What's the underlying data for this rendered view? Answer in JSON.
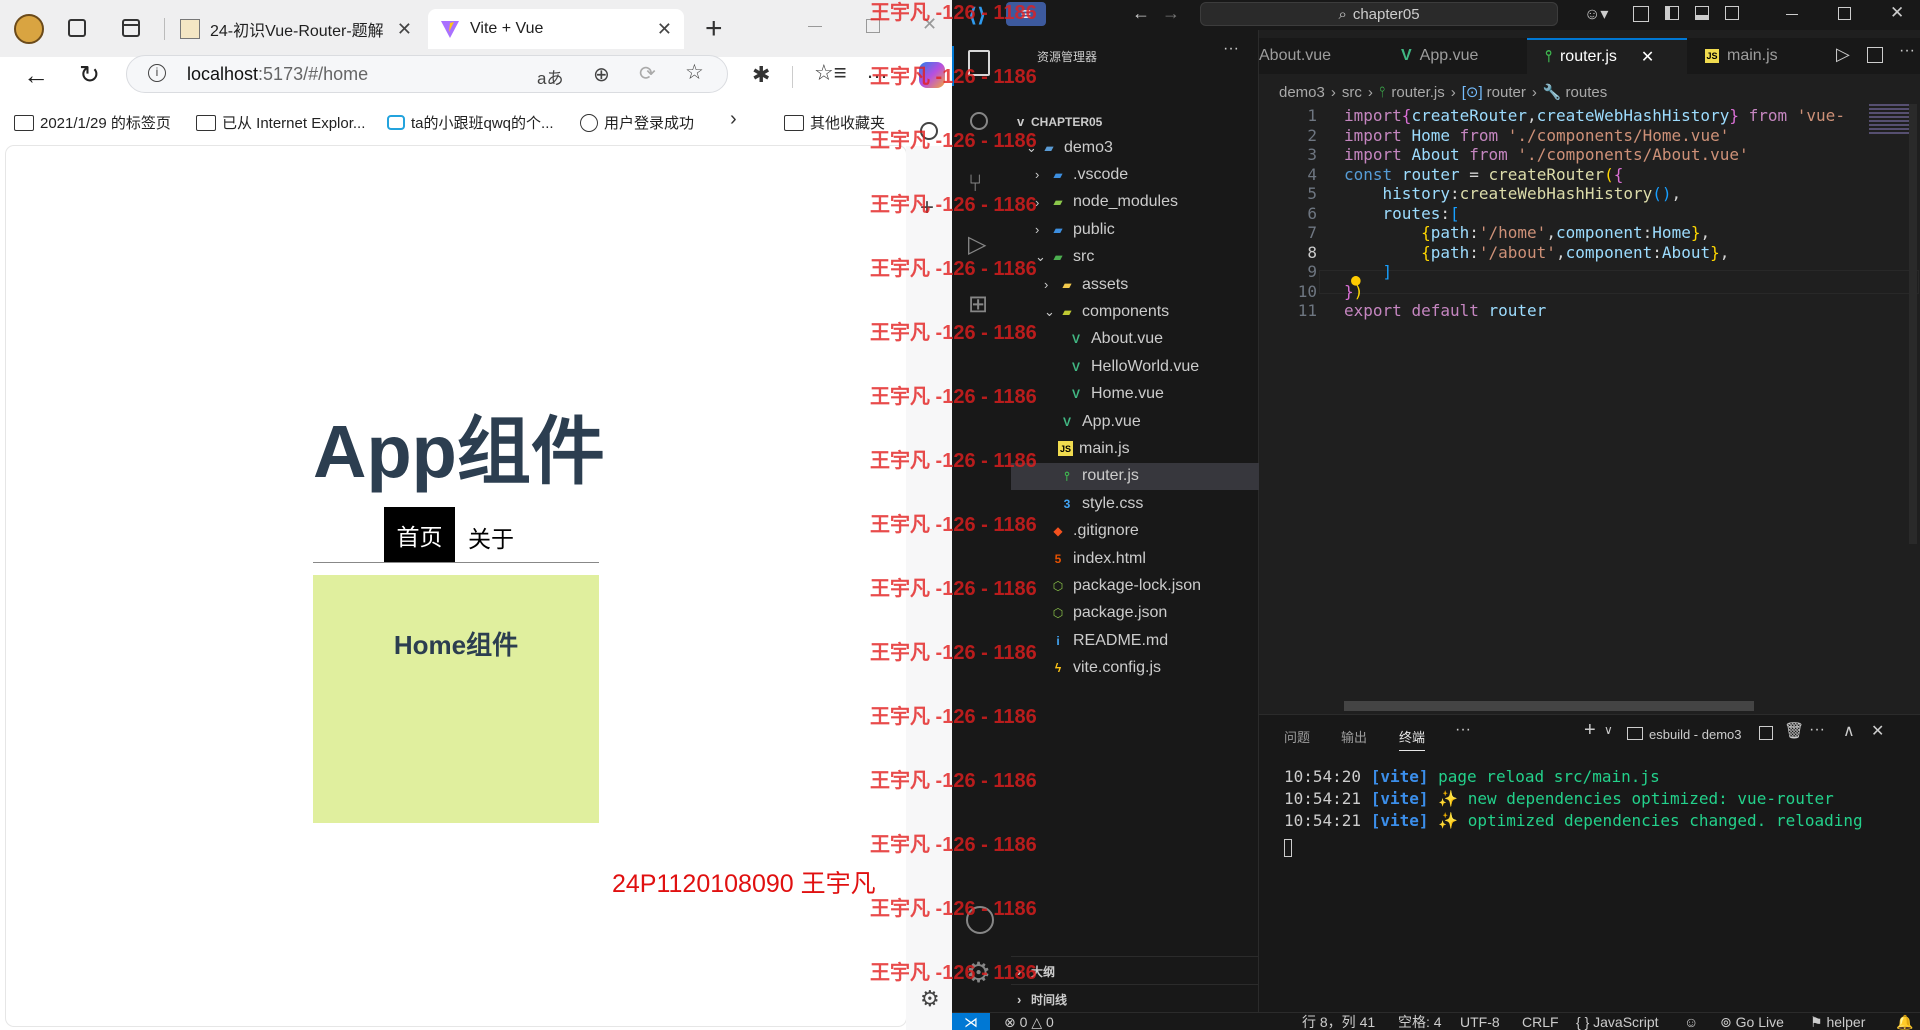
{
  "browser": {
    "tabs": [
      {
        "title": "24-初识Vue-Router-题解"
      },
      {
        "title": "Vite + Vue"
      }
    ],
    "url_host": "localhost",
    "url_rest": ":5173/#/home",
    "bookmarks": [
      {
        "label": "2021/1/29 的标签页",
        "icon": "folder-icon"
      },
      {
        "label": "已从 Internet Explor...",
        "icon": "folder-icon"
      },
      {
        "label": "ta的小跟班qwq的个...",
        "icon": "bilibili-icon"
      },
      {
        "label": "用户登录成功",
        "icon": "globe-icon"
      },
      {
        "label": "其他收藏夹",
        "icon": "folder-icon"
      }
    ],
    "page": {
      "app_title": "App组件",
      "nav_home": "首页",
      "nav_about": "关于",
      "home_title": "Home组件",
      "student_note": "24P1120108090 王宇凡"
    }
  },
  "watermark": "王宇凡 -126 - 1186",
  "vscode": {
    "title_search": "chapter05",
    "explorer_title": "资源管理器",
    "root": "CHAPTER05",
    "tree": [
      {
        "label": "demo3",
        "icon": "folder-open-icon",
        "chev": "v"
      },
      {
        "label": ".vscode",
        "icon": "folder-vscode-icon",
        "chev": ">"
      },
      {
        "label": "node_modules",
        "icon": "folder-node-icon",
        "chev": ">"
      },
      {
        "label": "public",
        "icon": "folder-public-icon",
        "chev": ">"
      },
      {
        "label": "src",
        "icon": "folder-src-icon",
        "chev": "v"
      },
      {
        "label": "assets",
        "icon": "folder-assets-icon",
        "chev": ">"
      },
      {
        "label": "components",
        "icon": "folder-components-icon",
        "chev": "v"
      },
      {
        "label": "About.vue",
        "icon": "vue-icon",
        "chev": ""
      },
      {
        "label": "HelloWorld.vue",
        "icon": "vue-icon",
        "chev": ""
      },
      {
        "label": "Home.vue",
        "icon": "vue-icon",
        "chev": ""
      },
      {
        "label": "App.vue",
        "icon": "vue-icon",
        "chev": ""
      },
      {
        "label": "main.js",
        "icon": "js-icon",
        "chev": ""
      },
      {
        "label": "router.js",
        "icon": "router-icon",
        "chev": ""
      },
      {
        "label": "style.css",
        "icon": "css-icon",
        "chev": ""
      },
      {
        "label": ".gitignore",
        "icon": "git-icon",
        "chev": ""
      },
      {
        "label": "index.html",
        "icon": "html-icon",
        "chev": ""
      },
      {
        "label": "package-lock.json",
        "icon": "npm-icon",
        "chev": ""
      },
      {
        "label": "package.json",
        "icon": "npm-icon",
        "chev": ""
      },
      {
        "label": "README.md",
        "icon": "info-icon",
        "chev": ""
      },
      {
        "label": "vite.config.js",
        "icon": "vite-icon",
        "chev": ""
      }
    ],
    "outline": "大纲",
    "timeline": "时间线",
    "editor_tabs": [
      {
        "label": "About.vue",
        "icon": "vue-icon"
      },
      {
        "label": "App.vue",
        "icon": "vue-icon"
      },
      {
        "label": "router.js",
        "icon": "router-icon"
      },
      {
        "label": "main.js",
        "icon": "js-icon"
      }
    ],
    "breadcrumb": [
      "demo3",
      "src",
      "router.js",
      "router",
      "routes"
    ],
    "line_numbers": [
      "1",
      "2",
      "3",
      "4",
      "5",
      "6",
      "7",
      "8",
      "9",
      "10",
      "11"
    ],
    "code": {
      "l1": [
        "import",
        "{",
        "createRouter",
        ",",
        "createWebHashHistory",
        "}",
        "from",
        "'vue-"
      ],
      "l2": [
        "import",
        "Home",
        "from",
        "'./components/Home.vue'"
      ],
      "l3": [
        "import",
        "About",
        "from",
        "'./components/About.vue'"
      ],
      "l4": [
        "const",
        "router",
        "=",
        "createRouter",
        "(",
        "{"
      ],
      "l5": [
        "history",
        ":",
        "createWebHashHistory",
        "()",
        ","
      ],
      "l6": [
        "routes",
        ":",
        "["
      ],
      "l7": [
        "{",
        "path",
        ":",
        "'/home'",
        ",",
        "component",
        ":",
        "Home",
        "}",
        ","
      ],
      "l8": [
        "{",
        "path",
        ":",
        "'/about'",
        ",",
        "component",
        ":",
        "About",
        "}",
        ","
      ],
      "l9": [
        "]"
      ],
      "l10": [
        "}",
        ")"
      ],
      "l11": [
        "export",
        "default",
        "router"
      ]
    },
    "panel_tabs": [
      "问题",
      "输出",
      "终端"
    ],
    "terminal_name": "esbuild - demo3",
    "terminal": [
      {
        "time": "10:54:20",
        "tag": "[vite]",
        "msg": "page reload ",
        "path": "src/main.js"
      },
      {
        "time": "10:54:21",
        "tag": "[vite]",
        "msg": "✨ new dependencies optimized: ",
        "path": "vue-router"
      },
      {
        "time": "10:54:21",
        "tag": "[vite]",
        "msg": "✨ optimized dependencies changed. reloading",
        "path": ""
      }
    ],
    "status": {
      "errors": "0",
      "warnings": "0",
      "cursor": "行 8，列 41",
      "spaces": "空格: 4",
      "encoding": "UTF-8",
      "eol": "CRLF",
      "language": "JavaScript",
      "golive": "Go Live",
      "helper": "helper"
    }
  }
}
